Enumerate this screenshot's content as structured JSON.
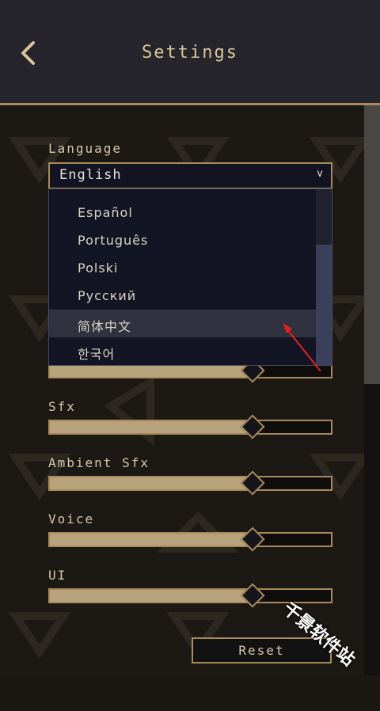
{
  "header": {
    "title": "Settings",
    "back_icon": "chevron-left-icon"
  },
  "language": {
    "label": "Language",
    "selected": "English",
    "dropdown_icon": "chevron-down-icon",
    "options": [
      "Español",
      "Português",
      "Polski",
      "Русский",
      "简体中文",
      "한국어"
    ],
    "highlighted_option": "简体中文"
  },
  "sliders": [
    {
      "label": "",
      "value": 0.72
    },
    {
      "label": "Sfx",
      "value": 0.72
    },
    {
      "label": "Ambient Sfx",
      "value": 0.72
    },
    {
      "label": "Voice",
      "value": 0.72
    },
    {
      "label": "UI",
      "value": 0.72
    }
  ],
  "reset_label": "Reset",
  "watermark": "千景软件站",
  "colors": {
    "accent": "#a88a5c",
    "header_bg": "#25252b",
    "annotation": "#e02020"
  }
}
